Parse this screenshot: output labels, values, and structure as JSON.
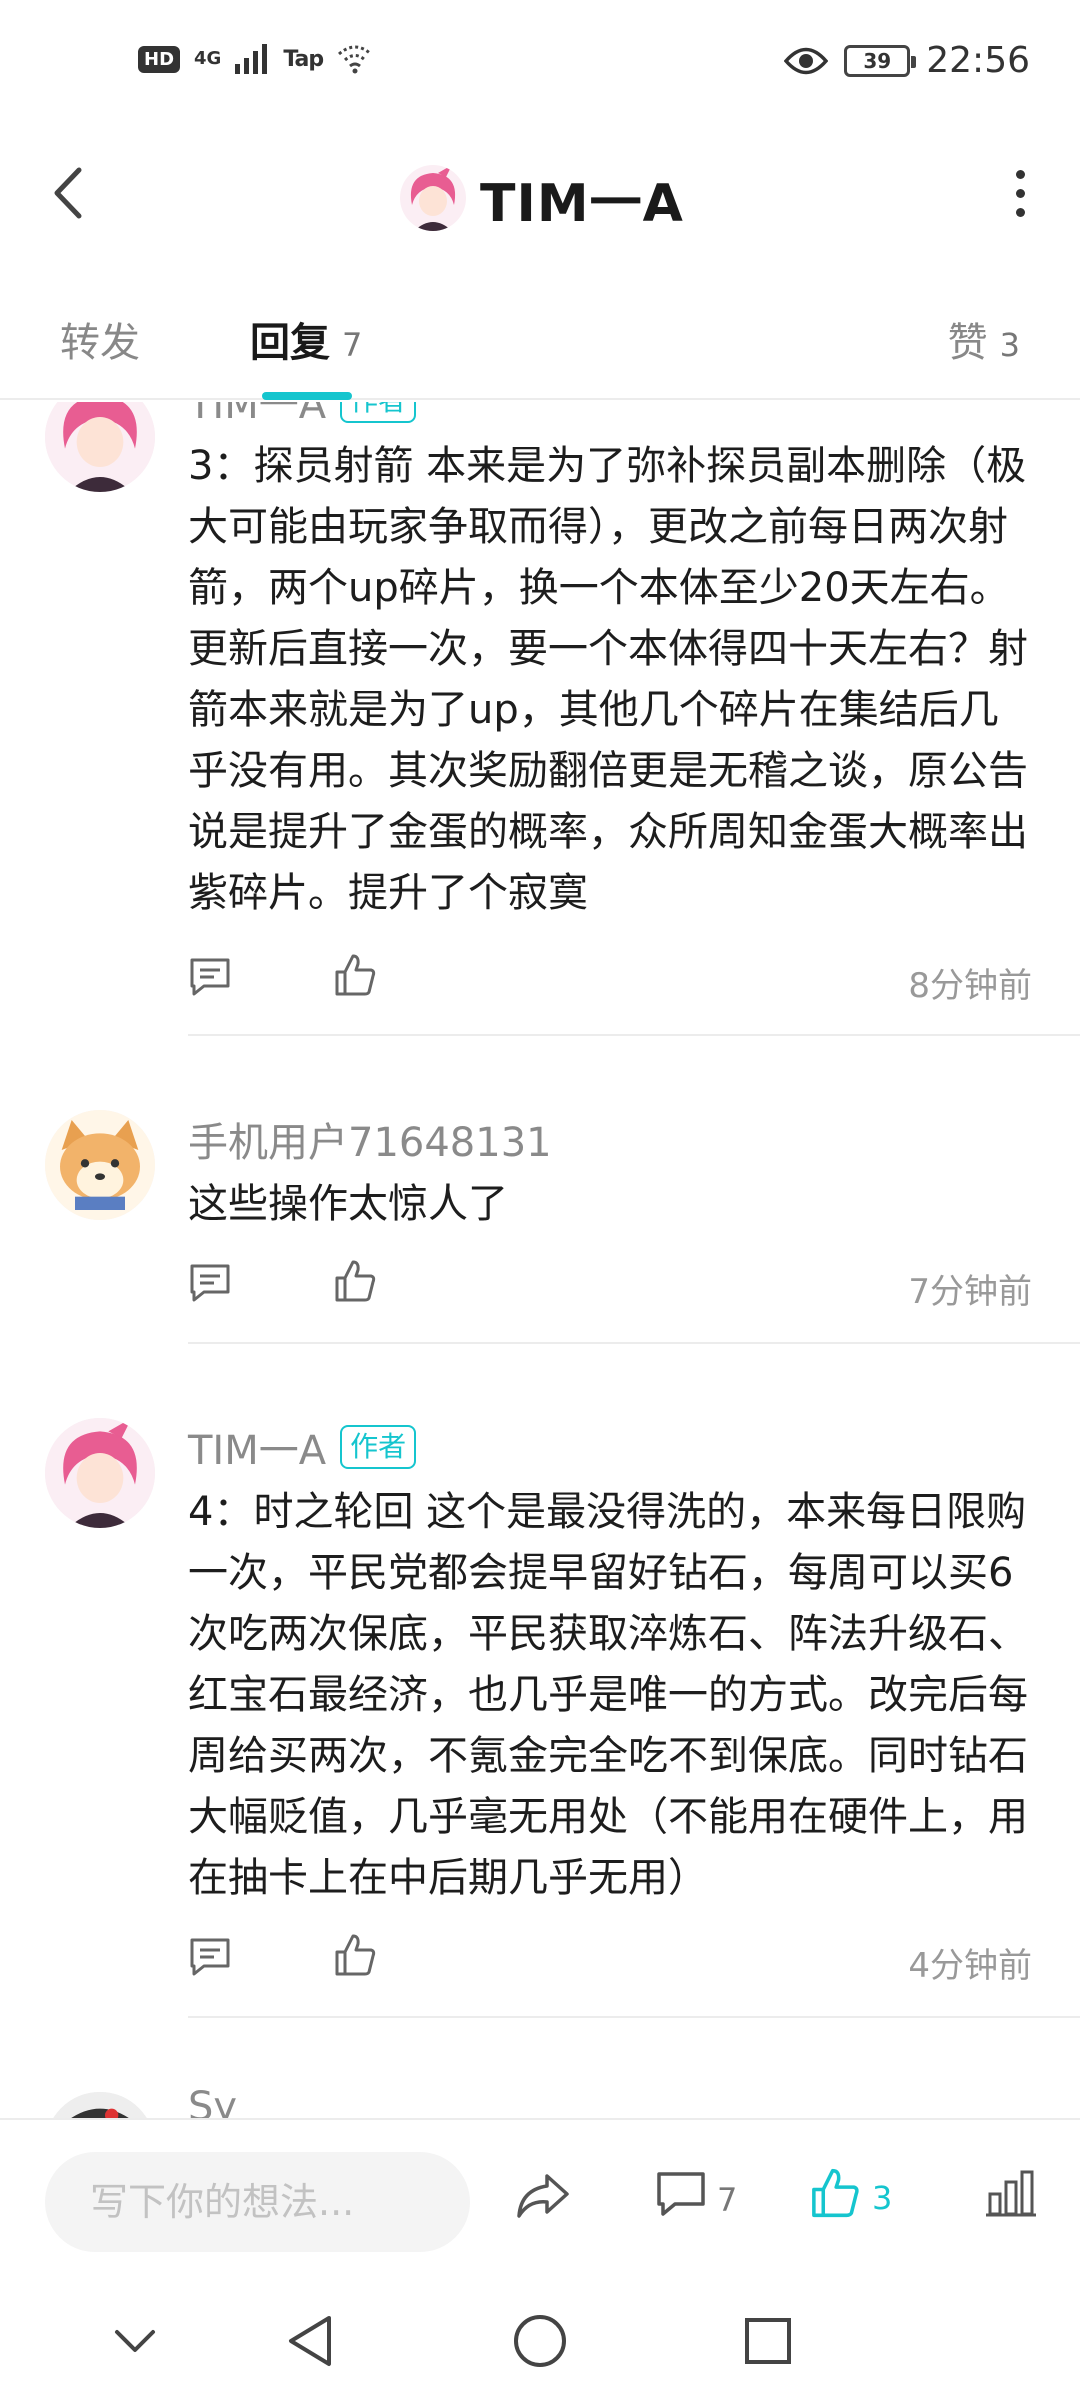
{
  "status_bar": {
    "hd": "HD",
    "network": "4G",
    "tap": "Tap",
    "battery": "39",
    "time": "22:56"
  },
  "header": {
    "title": "TIM一A"
  },
  "tabs": [
    {
      "label": "转发",
      "count": ""
    },
    {
      "label": "回复",
      "count": "7"
    },
    {
      "label": "赞",
      "count": "3"
    }
  ],
  "comments": [
    {
      "user": "TIM一A",
      "author_badge": "作者",
      "text": "3：探员射箭  本来是为了弥补探员副本删除（极大可能由玩家争取而得），更改之前每日两次射箭，两个up碎片，换一个本体至少20天左右。更新后直接一次，要一个本体得四十天左右？射箭本来就是为了up，其他几个碎片在集结后几乎没有用。其次奖励翻倍更是无稽之谈，原公告说是提升了金蛋的概率，众所周知金蛋大概率出紫碎片。提升了个寂寞",
      "time": "8分钟前"
    },
    {
      "user": "手机用户71648131",
      "author_badge": "",
      "text": "这些操作太惊人了",
      "time": "7分钟前"
    },
    {
      "user": "TIM一A",
      "author_badge": "作者",
      "text": "4：时之轮回  这个是最没得洗的，本来每日限购一次，平民党都会提早留好钻石，每周可以买6次吃两次保底，平民获取淬炼石、阵法升级石、红宝石最经济，也几乎是唯一的方式。改完后每周给买两次，不氪金完全吃不到保底。同时钻石大幅贬值，几乎毫无用处（不能用在硬件上，用在抽卡上在中后期几乎无用）",
      "time": "4分钟前"
    },
    {
      "user": "Sy",
      "author_badge": "",
      "text": "",
      "time": ""
    }
  ],
  "bottom_bar": {
    "input_placeholder": "写下你的想法...",
    "comment_count": "7",
    "like_count": "3"
  },
  "colors": {
    "accent": "#15c5ce",
    "text_primary": "#1d1d1d",
    "text_secondary": "#8a8a8a"
  }
}
